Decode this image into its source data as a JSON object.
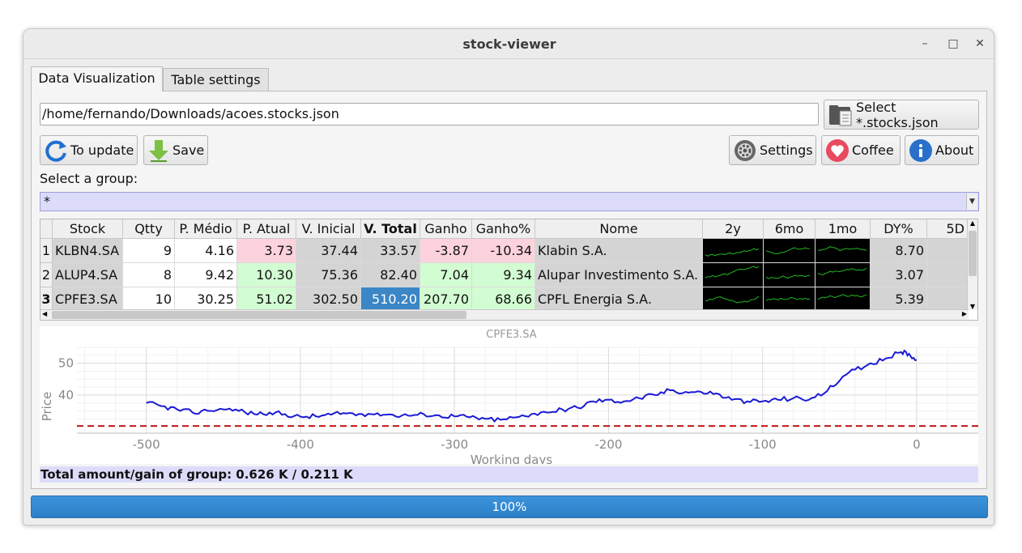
{
  "window": {
    "title": "stock-viewer",
    "minimize": "–",
    "maximize": "□",
    "close": "✕"
  },
  "tabs": [
    {
      "label": "Data Visualization",
      "active": true
    },
    {
      "label": "Table settings",
      "active": false
    }
  ],
  "file": {
    "path": "/home/fernando/Downloads/acoes.stocks.json",
    "select_label": "Select *.stocks.json"
  },
  "toolbar": {
    "update_label": "To update",
    "save_label": "Save",
    "settings_label": "Settings",
    "coffee_label": "Coffee",
    "about_label": "About"
  },
  "group": {
    "label": "Select a group:",
    "value": "*"
  },
  "table": {
    "headers": [
      "Stock",
      "Qtty",
      "P. Médio",
      "P. Atual",
      "V. Inicial",
      "V. Total",
      "Ganho",
      "Ganho%",
      "Nome",
      "2y",
      "6mo",
      "1mo",
      "DY%",
      "5D"
    ],
    "rows": [
      {
        "index": "1",
        "stock": "KLBN4.SA",
        "qtty": "9",
        "pmedio": "4.16",
        "patual": "3.73",
        "vinicial": "37.44",
        "vtotal": "33.57",
        "ganho": "-3.87",
        "ganho_pct": "-10.34",
        "nome": "Klabin S.A.",
        "dy": "8.70"
      },
      {
        "index": "2",
        "stock": "ALUP4.SA",
        "qtty": "8",
        "pmedio": "9.42",
        "patual": "10.30",
        "vinicial": "75.36",
        "vtotal": "82.40",
        "ganho": "7.04",
        "ganho_pct": "9.34",
        "nome": "Alupar Investimento S.A.",
        "dy": "3.07"
      },
      {
        "index": "3",
        "stock": "CPFE3.SA",
        "qtty": "10",
        "pmedio": "30.25",
        "patual": "51.02",
        "vinicial": "302.50",
        "vtotal": "510.20",
        "ganho": "207.70",
        "ganho_pct": "68.66",
        "nome": "CPFL Energia S.A.",
        "dy": "5.39"
      }
    ],
    "colors": {
      "negative": "#fcd2dc",
      "positive": "#d2fcd2",
      "neutral": "#d4d4d4",
      "selected": "#3b86c6"
    }
  },
  "chart_data": {
    "type": "line",
    "title": "CPFE3.SA",
    "xlabel": "Working days",
    "ylabel": "Price",
    "xlim": [
      -545,
      40
    ],
    "ylim": [
      28,
      55
    ],
    "xticks": [
      "-500",
      "-400",
      "-300",
      "-200",
      "-100",
      "0"
    ],
    "yticks": [
      "40",
      "50"
    ],
    "grid": true,
    "series": [
      {
        "type": "line",
        "color": "#1a1ad6",
        "x": [
          -500,
          -490,
          -480,
          -470,
          -460,
          -450,
          -440,
          -430,
          -420,
          -410,
          -400,
          -390,
          -380,
          -370,
          -360,
          -350,
          -340,
          -330,
          -320,
          -310,
          -300,
          -290,
          -280,
          -270,
          -260,
          -250,
          -240,
          -230,
          -220,
          -210,
          -200,
          -190,
          -180,
          -170,
          -160,
          -150,
          -140,
          -130,
          -120,
          -110,
          -100,
          -90,
          -80,
          -70,
          -60,
          -50,
          -40,
          -30,
          -20,
          -10,
          -5,
          0
        ],
        "y": [
          37.5,
          36.5,
          35.5,
          34.5,
          35.0,
          35.5,
          35.0,
          34.0,
          34.5,
          34.0,
          33.2,
          33.3,
          33.8,
          34.2,
          34.0,
          34.3,
          33.8,
          33.5,
          34.0,
          33.6,
          33.3,
          33.0,
          32.5,
          32.2,
          33.0,
          34.0,
          34.5,
          35.5,
          36.0,
          38.0,
          38.5,
          38.0,
          39.0,
          40.0,
          41.5,
          41.0,
          41.0,
          40.5,
          38.5,
          38.0,
          38.0,
          38.5,
          39.0,
          38.5,
          40.5,
          44.5,
          48.0,
          50.0,
          51.5,
          53.5,
          53.0,
          51.0
        ]
      },
      {
        "type": "line",
        "style": "dashed",
        "color": "#c01818",
        "x": [
          -545,
          40
        ],
        "y": [
          30.25,
          30.25
        ]
      }
    ]
  },
  "status": "Total amount/gain of group: 0.626 K / 0.211 K",
  "progress": {
    "value": 100,
    "label": "100%"
  }
}
